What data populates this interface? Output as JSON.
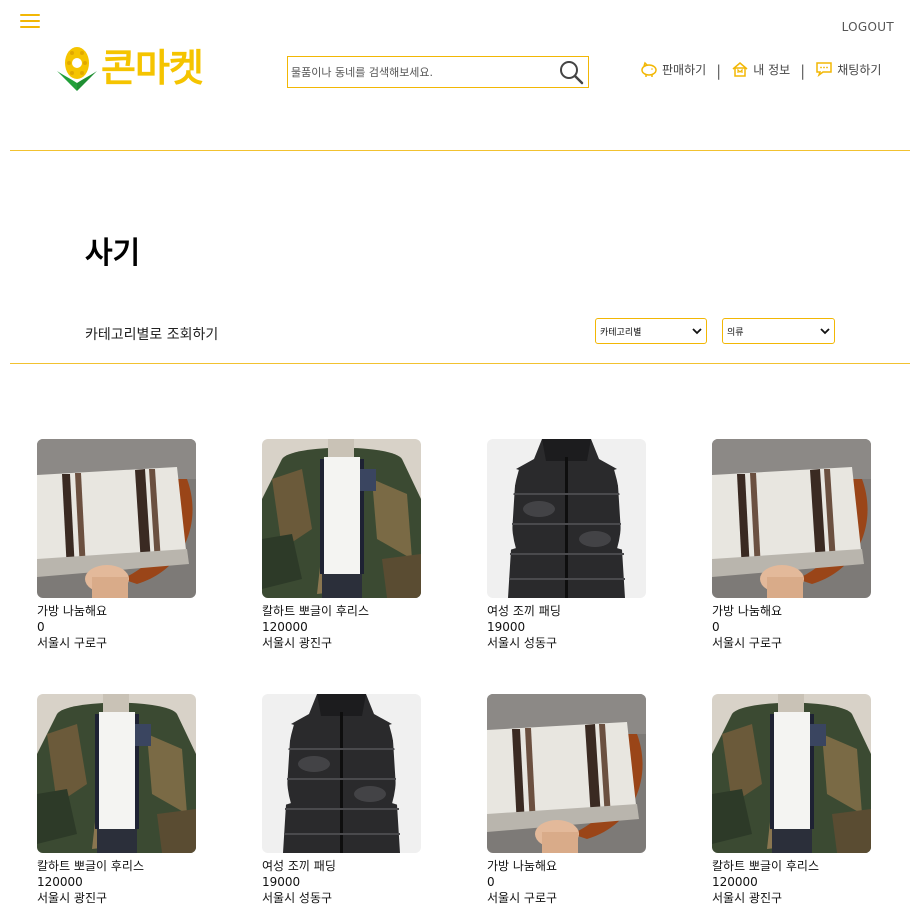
{
  "header": {
    "logo_text": "콘마켓",
    "logout_label": "LOGOUT",
    "search_placeholder": "물품이나 동네를 검색해보세요.",
    "nav": [
      {
        "label": "판매하기",
        "icon": "piggy-bank-icon"
      },
      {
        "label": "내 정보",
        "icon": "home-icon"
      },
      {
        "label": "채팅하기",
        "icon": "chat-bubble-icon"
      }
    ],
    "nav_separator": "|"
  },
  "page": {
    "title": "사기",
    "filter_label": "카테고리별로 조회하기",
    "filter_select": "카테고리별",
    "category_select": "의류"
  },
  "colors": {
    "accent": "#f2b705",
    "logo_yellow": "#f5c400",
    "logo_green": "#22a03a"
  },
  "products": [
    {
      "name": "가방 나눔해요",
      "price": "0",
      "location": "서울시 구로구",
      "image": "woven-bag"
    },
    {
      "name": "칼하트 뽀글이 후리스",
      "price": "120000",
      "location": "서울시 광진구",
      "image": "camo-fleece"
    },
    {
      "name": "여성 조끼 패딩",
      "price": "19000",
      "location": "서울시 성동구",
      "image": "puffer-vest"
    },
    {
      "name": "가방 나눔해요",
      "price": "0",
      "location": "서울시 구로구",
      "image": "woven-bag"
    },
    {
      "name": "칼하트 뽀글이 후리스",
      "price": "120000",
      "location": "서울시 광진구",
      "image": "camo-fleece"
    },
    {
      "name": "여성 조끼 패딩",
      "price": "19000",
      "location": "서울시 성동구",
      "image": "puffer-vest"
    },
    {
      "name": "가방 나눔해요",
      "price": "0",
      "location": "서울시 구로구",
      "image": "woven-bag"
    },
    {
      "name": "칼하트 뽀글이 후리스",
      "price": "120000",
      "location": "서울시 광진구",
      "image": "camo-fleece"
    }
  ]
}
